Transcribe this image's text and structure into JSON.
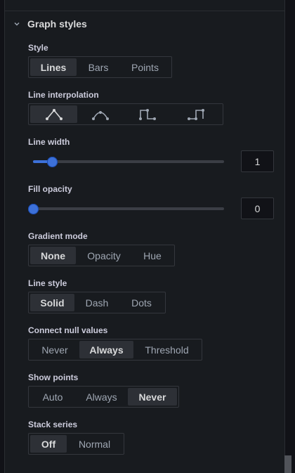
{
  "section": {
    "title": "Graph styles"
  },
  "style": {
    "label": "Style",
    "options": [
      "Lines",
      "Bars",
      "Points"
    ],
    "selected": "Lines"
  },
  "line_interpolation": {
    "label": "Line interpolation",
    "options": [
      "linear-icon",
      "smooth-icon",
      "step-before-icon",
      "step-after-icon"
    ],
    "selected": "linear-icon"
  },
  "line_width": {
    "label": "Line width",
    "value": "1",
    "min": 0,
    "max": 10,
    "value_num": 1
  },
  "fill_opacity": {
    "label": "Fill opacity",
    "value": "0",
    "min": 0,
    "max": 100,
    "value_num": 0
  },
  "gradient_mode": {
    "label": "Gradient mode",
    "options": [
      "None",
      "Opacity",
      "Hue"
    ],
    "selected": "None"
  },
  "line_style": {
    "label": "Line style",
    "options": [
      "Solid",
      "Dash",
      "Dots"
    ],
    "selected": "Solid"
  },
  "connect_null": {
    "label": "Connect null values",
    "options": [
      "Never",
      "Always",
      "Threshold"
    ],
    "selected": "Always"
  },
  "show_points": {
    "label": "Show points",
    "options": [
      "Auto",
      "Always",
      "Never"
    ],
    "selected": "Never"
  },
  "stack_series": {
    "label": "Stack series",
    "options": [
      "Off",
      "Normal"
    ],
    "selected": "Off"
  },
  "colors": {
    "accent": "#3d71d9",
    "panel": "#181b1f",
    "active": "#2d3036"
  }
}
